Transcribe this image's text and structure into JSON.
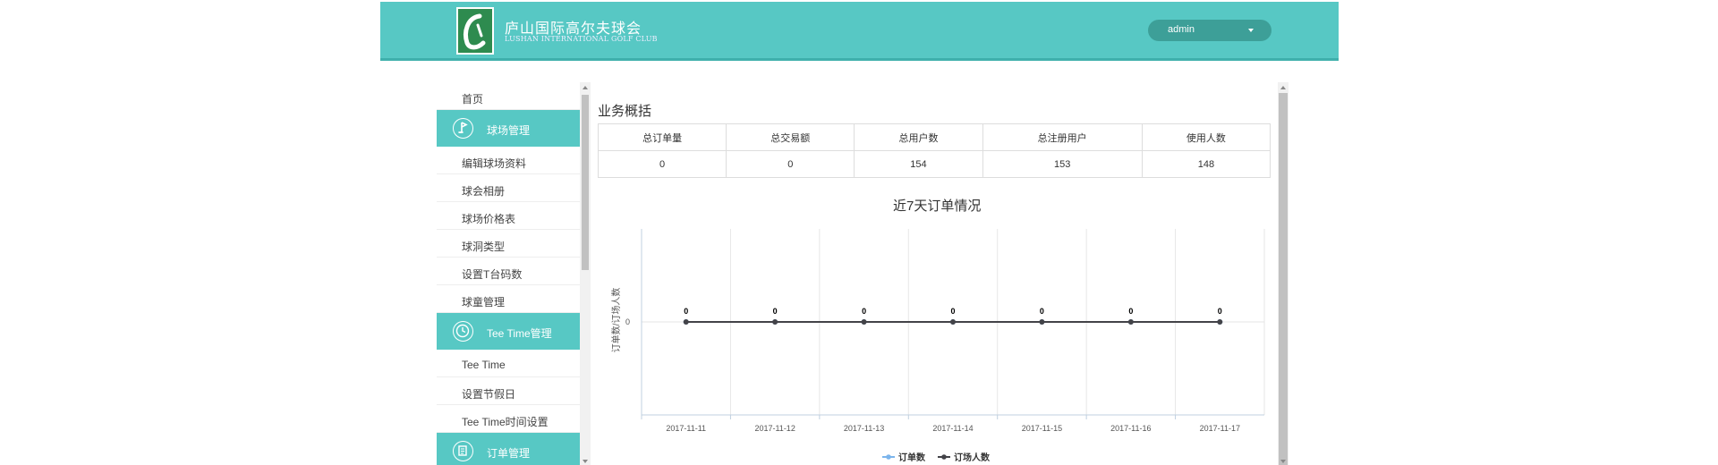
{
  "header": {
    "logo_title": "庐山国际高尔夫球会",
    "logo_subtitle": "LUSHAN INTERNATIONAL GOLF CLUB",
    "user": "admin"
  },
  "sidebar": {
    "items": [
      {
        "type": "link",
        "label": "首页"
      },
      {
        "type": "group",
        "label": "球场管理",
        "icon": "golf-flag-icon"
      },
      {
        "type": "link",
        "label": "编辑球场资料"
      },
      {
        "type": "link",
        "label": "球会相册"
      },
      {
        "type": "link",
        "label": "球场价格表"
      },
      {
        "type": "link",
        "label": "球洞类型"
      },
      {
        "type": "link",
        "label": "设置T台码数"
      },
      {
        "type": "link",
        "label": "球童管理"
      },
      {
        "type": "group",
        "label": "Tee Time管理",
        "icon": "clock-icon"
      },
      {
        "type": "link",
        "label": "Tee Time"
      },
      {
        "type": "link",
        "label": "设置节假日"
      },
      {
        "type": "link",
        "label": "Tee Time时间设置"
      },
      {
        "type": "group",
        "label": "订单管理",
        "icon": "document-icon"
      }
    ]
  },
  "overview": {
    "title": "业务概括",
    "headers": [
      "总订单量",
      "总交易额",
      "总用户数",
      "总注册用户",
      "使用人数"
    ],
    "values": [
      "0",
      "0",
      "154",
      "153",
      "148"
    ]
  },
  "chart_data": {
    "type": "line",
    "title": "近7天订单情况",
    "ylabel": "订单数/订场人数",
    "y_ticks": [
      "0"
    ],
    "categories": [
      "2017-11-11",
      "2017-11-12",
      "2017-11-13",
      "2017-11-14",
      "2017-11-15",
      "2017-11-16",
      "2017-11-17"
    ],
    "series": [
      {
        "name": "订单数",
        "values": [
          0,
          0,
          0,
          0,
          0,
          0,
          0
        ],
        "color": "#7cb5ec"
      },
      {
        "name": "订场人数",
        "values": [
          0,
          0,
          0,
          0,
          0,
          0,
          0
        ],
        "color": "#434348"
      }
    ],
    "legend": "bottom"
  }
}
